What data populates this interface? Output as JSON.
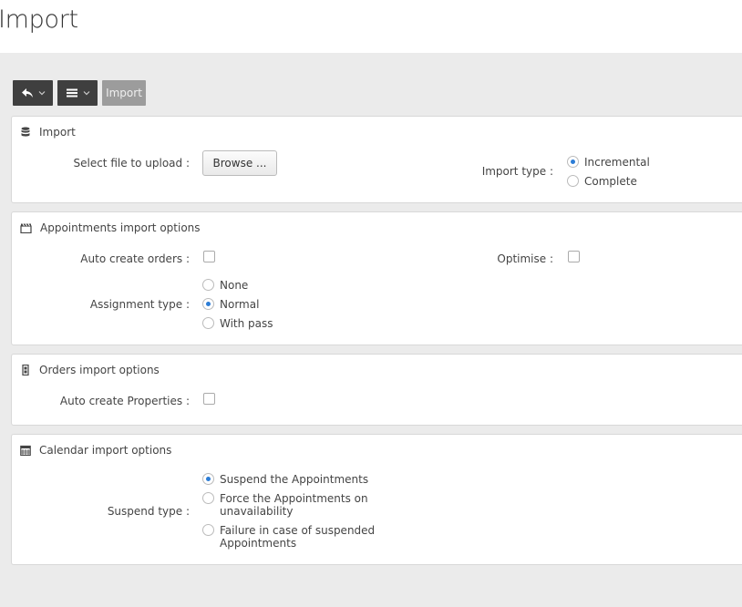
{
  "page": {
    "title": "Import"
  },
  "toolbar": {
    "import_label": "Import"
  },
  "import_panel": {
    "title": "Import",
    "file_label": "Select file to upload :",
    "browse_label": "Browse ...",
    "import_type_label": "Import type :",
    "import_type_options": [
      {
        "label": "Incremental",
        "checked": true
      },
      {
        "label": "Complete",
        "checked": false
      }
    ]
  },
  "appointments_panel": {
    "title": "Appointments import options",
    "auto_create_orders_label": "Auto create orders :",
    "auto_create_orders_checked": false,
    "optimise_label": "Optimise :",
    "optimise_checked": false,
    "assignment_type_label": "Assignment type :",
    "assignment_type_options": [
      {
        "label": "None",
        "checked": false
      },
      {
        "label": "Normal",
        "checked": true
      },
      {
        "label": "With pass",
        "checked": false
      }
    ]
  },
  "orders_panel": {
    "title": "Orders import options",
    "auto_create_properties_label": "Auto create Properties :",
    "auto_create_properties_checked": false
  },
  "calendar_panel": {
    "title": "Calendar import options",
    "suspend_type_label": "Suspend type :",
    "suspend_type_options": [
      {
        "line1": "Suspend the Appointments",
        "line2": "",
        "checked": true
      },
      {
        "line1": "Force the Appointments on",
        "line2": "unavailability",
        "checked": false
      },
      {
        "line1": "Failure in case of suspended",
        "line2": "Appointments",
        "checked": false
      }
    ]
  },
  "colors": {
    "radio_checked": "#2c7dd6",
    "toolbar_button": "#3f3f3f",
    "toolbar_disabled": "#9c9c9c"
  }
}
